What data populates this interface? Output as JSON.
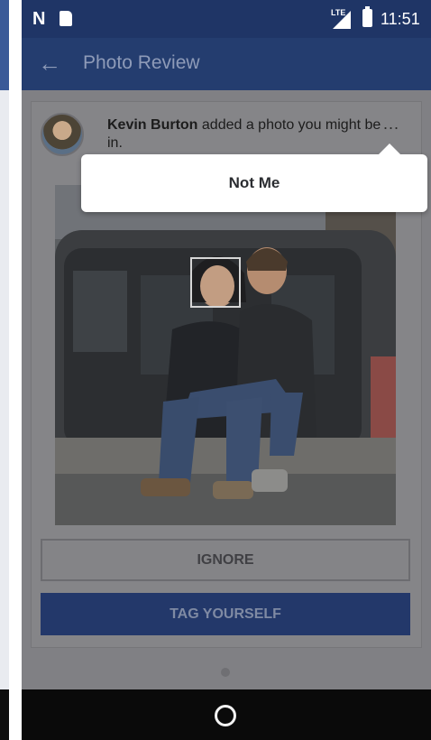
{
  "status_bar": {
    "network_type": "LTE",
    "time": "11:51",
    "icons": [
      "n-icon",
      "sd-card-icon",
      "signal-icon",
      "battery-icon"
    ]
  },
  "app_bar": {
    "title": "Photo Review",
    "back_icon": "arrow-left-icon"
  },
  "post": {
    "author": "Kevin Burton",
    "message": " added a photo you might be in.",
    "more_label": "...",
    "face_outline": true
  },
  "actions": {
    "ignore_label": "IGNORE",
    "tag_label": "TAG YOURSELF"
  },
  "menu": {
    "items": [
      {
        "label": "Not Me"
      }
    ]
  },
  "colors": {
    "brand": "#243d6f",
    "status_bar": "#1f3566",
    "overlay": "#808084",
    "popup": "#ffffff"
  }
}
